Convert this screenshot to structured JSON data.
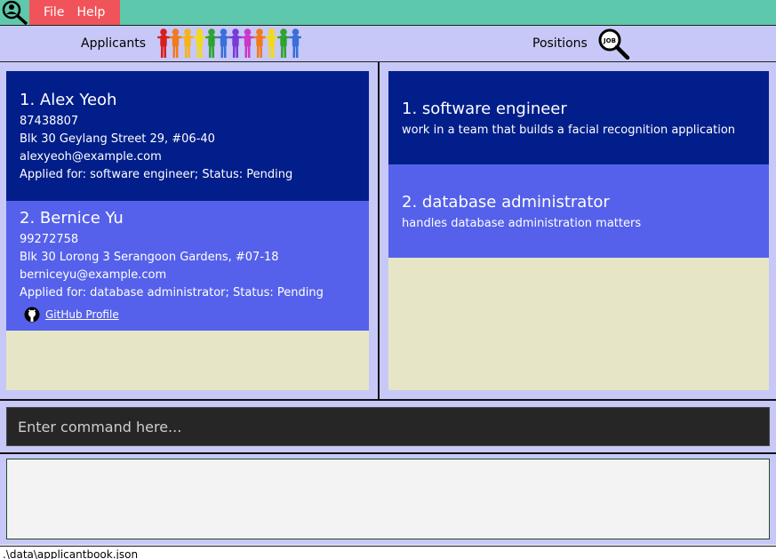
{
  "menu": {
    "file_label": "File",
    "help_label": "Help"
  },
  "header": {
    "applicants_label": "Applicants",
    "positions_label": "Positions"
  },
  "applicants": [
    {
      "name": "1.  Alex Yeoh",
      "phone": "87438807",
      "address": "Blk 30 Geylang Street 29, #06-40",
      "email": "alexyeoh@example.com",
      "applied": "Applied for: software engineer; Status: Pending"
    },
    {
      "name": "2.  Bernice Yu",
      "phone": "99272758",
      "address": "Blk 30 Lorong 3 Serangoon Gardens, #07-18",
      "email": "berniceyu@example.com",
      "applied": "Applied for: database administrator; Status: Pending",
      "github_label": "GitHub Profile"
    }
  ],
  "positions": [
    {
      "title": "1.  software engineer",
      "description": "work in a team that builds a facial recognition application"
    },
    {
      "title": "2.  database administrator",
      "description": "handles database administration matters"
    }
  ],
  "command": {
    "placeholder": "Enter command here..."
  },
  "status": {
    "path": ".\\data\\applicantbook.json"
  },
  "colors": {
    "menubar": "#5dc8ac",
    "menu_group": "#f0545a",
    "panel_bg": "#c8c8f8",
    "card_dark": "#011e8a",
    "card_light": "#5561ea",
    "list_bg": "#e6e6c6",
    "command_bg": "#262626"
  },
  "icons": {
    "app": "search-person-icon",
    "applicants": "people-chain-icon",
    "positions": "job-search-icon",
    "github": "github-icon"
  }
}
